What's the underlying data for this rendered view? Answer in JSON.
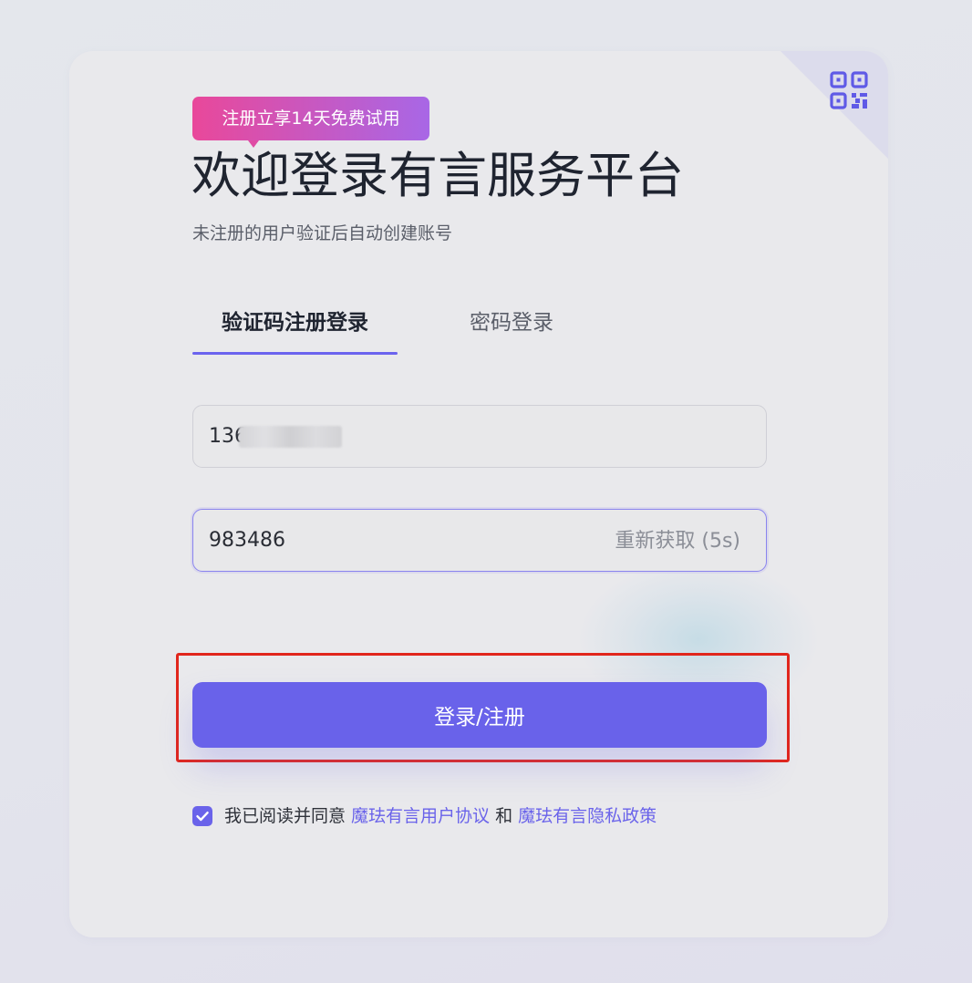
{
  "badge": {
    "text": "注册立享14天免费试用"
  },
  "header": {
    "title": "欢迎登录有言服务平台",
    "subtitle": "未注册的用户验证后自动创建账号"
  },
  "tabs": [
    {
      "label": "验证码注册登录",
      "active": true
    },
    {
      "label": "密码登录",
      "active": false
    }
  ],
  "form": {
    "phone_value": "136",
    "phone_masked": true,
    "code_value": "983486",
    "resend_label": "重新获取 (5s)",
    "submit_label": "登录/注册"
  },
  "agreement": {
    "checked": true,
    "prefix": "我已阅读并同意 ",
    "terms_link": "魔珐有言用户协议",
    "connector": " 和 ",
    "privacy_link": "魔珐有言隐私政策"
  },
  "icons": {
    "corner": "qr-code-icon",
    "checkbox": "checkmark-icon"
  },
  "colors": {
    "accent": "#6962ea",
    "badge_start": "#e9489a",
    "badge_end": "#a867e6",
    "highlight_border": "#e1261c",
    "title": "#1f2430"
  }
}
